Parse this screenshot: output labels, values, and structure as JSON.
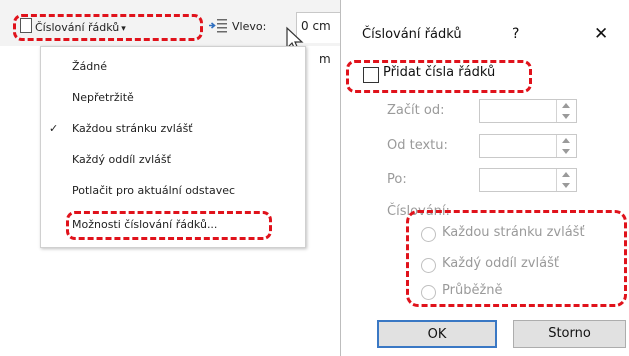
{
  "ribbon": {
    "line_numbers_button": "Číslování řádků",
    "indent_left_label": "Vlevo:",
    "indent_left_value": "0 cm",
    "row2_unit": "m"
  },
  "menu": {
    "items": [
      {
        "label": "Žádné",
        "checked": false
      },
      {
        "label": "Nepřetržitě",
        "checked": false
      },
      {
        "label": "Každou stránku zvlášť",
        "checked": true
      },
      {
        "label": "Každý oddíl zvlášť",
        "checked": false
      },
      {
        "label": "Potlačit pro aktuální odstavec",
        "checked": false
      },
      {
        "label": "Možnosti číslování řádků...",
        "checked": false
      }
    ],
    "check_glyph": "✓"
  },
  "dialog": {
    "title": "Číslování řádků",
    "help": "?",
    "close": "✕",
    "add_checkbox_label": "Přidat čísla řádků",
    "add_checked": false,
    "start_at_label": "Začít od:",
    "from_text_label": "Od textu:",
    "by_label": "Po:",
    "start_at_value": "",
    "from_text_value": "",
    "by_value": "",
    "numbering_group_label": "Číslování:",
    "radios": [
      {
        "label": "Každou stránku zvlášť",
        "selected": false
      },
      {
        "label": "Každý oddíl zvlášť",
        "selected": false
      },
      {
        "label": "Průběžně",
        "selected": false
      }
    ],
    "ok": "OK",
    "cancel": "Storno"
  },
  "colors": {
    "highlight": "#e0121b",
    "disabled_text": "#9a9a9a",
    "ok_border": "#3a78c4"
  },
  "icons": [
    "document-icon",
    "indent-left-icon",
    "mouse-cursor-icon",
    "checkmark-icon",
    "help-icon",
    "close-icon",
    "spinner-up-icon",
    "spinner-down-icon"
  ]
}
